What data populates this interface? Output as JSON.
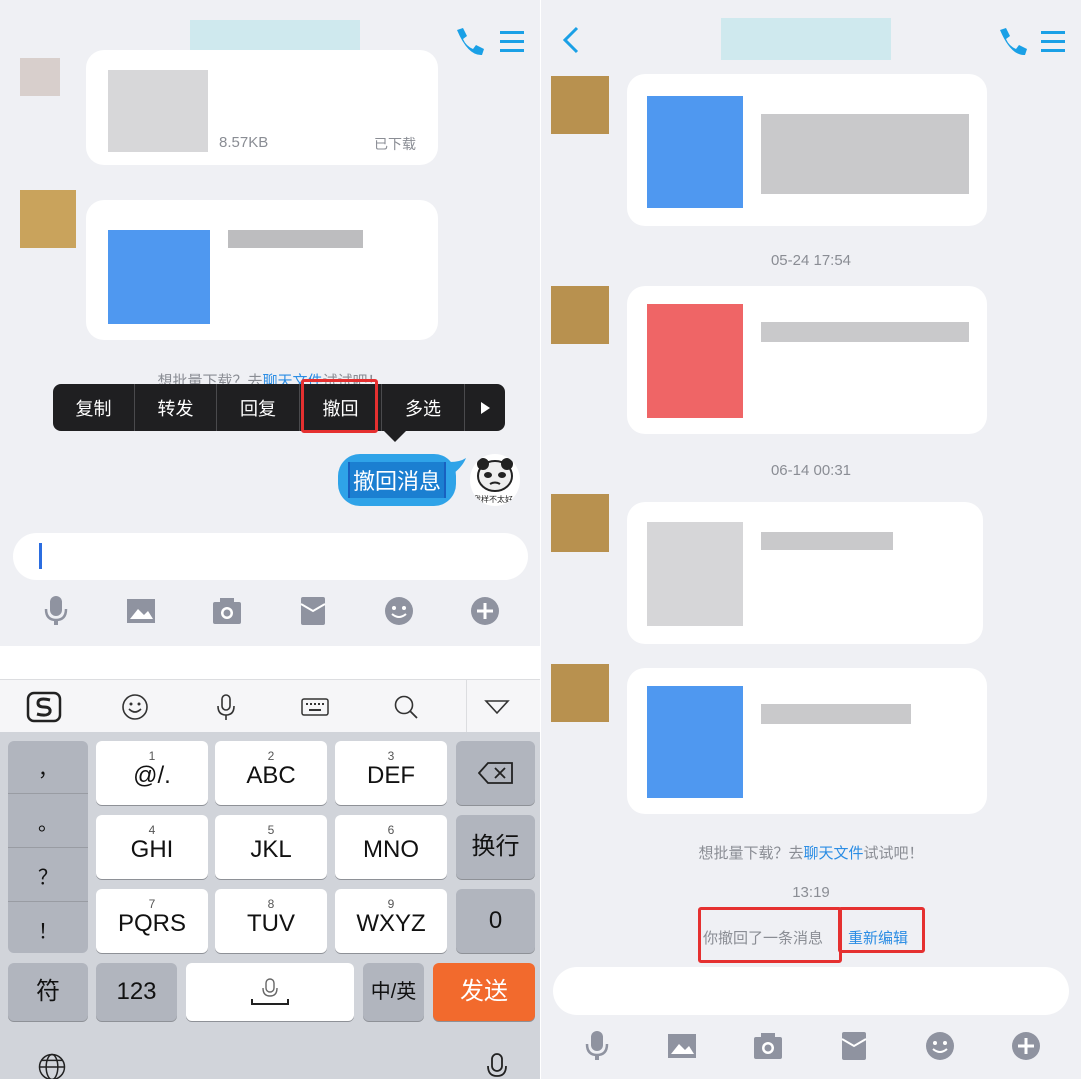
{
  "left": {
    "file_size": "8.57KB",
    "file_status": "已下载",
    "hint": {
      "prefix": "想批量下载？去",
      "link": "聊天文件",
      "suffix": "试试吧！"
    },
    "popup_menu": [
      "复制",
      "转发",
      "回复",
      "撤回",
      "多选"
    ],
    "message_text": "撤回消息",
    "avatar_caption": "我样不太好",
    "keyboard": {
      "punctuation": [
        "，",
        "。",
        "？",
        "！"
      ],
      "row1": [
        {
          "num": "1",
          "label": "@/."
        },
        {
          "num": "2",
          "label": "ABC"
        },
        {
          "num": "3",
          "label": "DEF"
        }
      ],
      "row2": [
        {
          "num": "4",
          "label": "GHI"
        },
        {
          "num": "5",
          "label": "JKL"
        },
        {
          "num": "6",
          "label": "MNO"
        }
      ],
      "row3": [
        {
          "num": "7",
          "label": "PQRS"
        },
        {
          "num": "8",
          "label": "TUV"
        },
        {
          "num": "9",
          "label": "WXYZ"
        }
      ],
      "newline": "换行",
      "zero": "0",
      "symbols": "符",
      "numbers": "123",
      "lang": "中/英",
      "send": "发送"
    }
  },
  "right": {
    "timestamp_1": "05-24 17:54",
    "timestamp_2": "06-14 00:31",
    "hint": {
      "prefix": "想批量下载？去",
      "link": "聊天文件",
      "suffix": "试试吧！"
    },
    "timestamp_3": "13:19",
    "recall_notice": "你撤回了一条消息",
    "re_edit": "重新编辑"
  },
  "colors": {
    "accent": "#2b8de4",
    "highlight": "#e53030",
    "send": "#f26a2d",
    "bubble": "#2fa3e8"
  }
}
